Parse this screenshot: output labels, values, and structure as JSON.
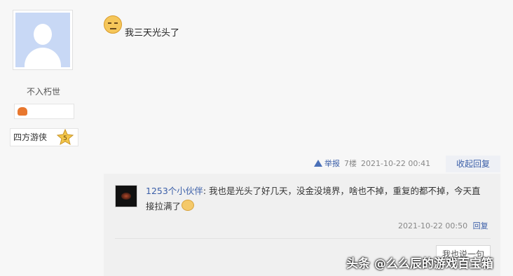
{
  "user": {
    "name": "不入朽世",
    "level_title": "四方游侠",
    "level_number": "5"
  },
  "post": {
    "content": "我三天光头了"
  },
  "post_meta": {
    "report_label": "举报",
    "floor": "7楼",
    "time": "2021-10-22 00:41",
    "collapse_label": "收起回复"
  },
  "reply": {
    "user": "1253个小伙伴",
    "separator": ":",
    "content": "我也是光头了好几天，没金没境界，啥也不掉，重复的都不掉，今天直接拉满了",
    "time": "2021-10-22 00:50",
    "reply_label": "回复"
  },
  "reply_box": {
    "say_button": "我也说一句"
  },
  "watermark": "头条 @么么辰的游戏百宝箱",
  "colors": {
    "link": "#3a5ea8",
    "background": "#f7f7f7",
    "reply_background": "#f0f0f0"
  }
}
